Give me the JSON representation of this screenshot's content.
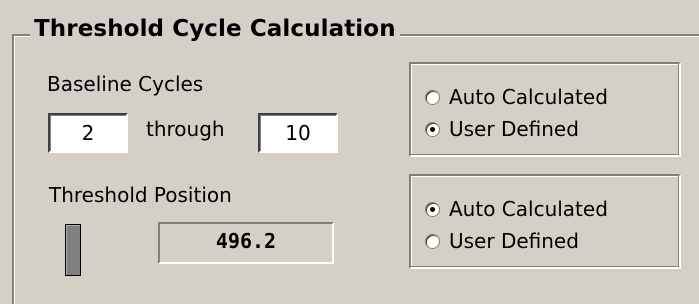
{
  "group": {
    "title": "Threshold Cycle Calculation"
  },
  "baseline": {
    "label": "Baseline Cycles",
    "start_value": "2",
    "through_label": "through",
    "end_value": "10",
    "mode": {
      "options": [
        "Auto Calculated",
        "User Defined"
      ],
      "selected": "User Defined"
    }
  },
  "threshold": {
    "label": "Threshold Position",
    "value": "496.2",
    "mode": {
      "options": [
        "Auto Calculated",
        "User Defined"
      ],
      "selected": "Auto Calculated"
    }
  }
}
